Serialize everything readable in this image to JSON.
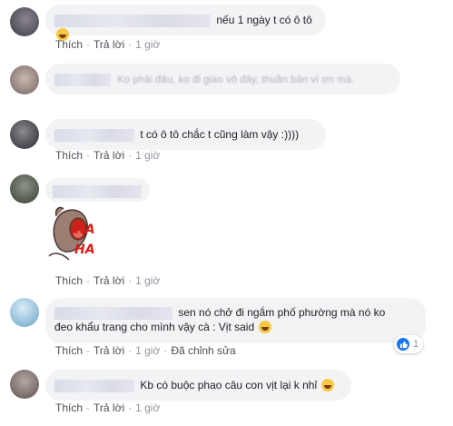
{
  "actions": {
    "like": "Thích",
    "reply": "Trả lời",
    "separator": "·",
    "time": "1 giờ",
    "edited": "Đã chỉnh sửa"
  },
  "comments": [
    {
      "text": "nếu 1 ngày t có ô tô"
    },
    {
      "text": "Ko phải đâu, ko đi giao vô đây, thuần bán vì ơn mà."
    },
    {
      "text": "t có ô tô chắc t cũng làm vậy :))))"
    },
    {
      "sticker_text": "HA HA"
    },
    {
      "text_line1": "sen nó chở đi ngắm phố phường mà nó ko",
      "text_line2": "đeo khẩu trang cho mình vậy cà : Vịt said",
      "reaction_count": "1"
    },
    {
      "text": "Kb có buộc phao câu con vịt lại k nhỉ"
    }
  ],
  "icons": {
    "laugh": "rofl-emoji",
    "grin": "grinning-emoji",
    "think": "thinking-emoji",
    "like": "like-icon"
  },
  "colors": {
    "bubble": "#f2f3f5",
    "link": "#4b4f56",
    "meta": "#90949c",
    "like_blue": "#1877f2"
  }
}
